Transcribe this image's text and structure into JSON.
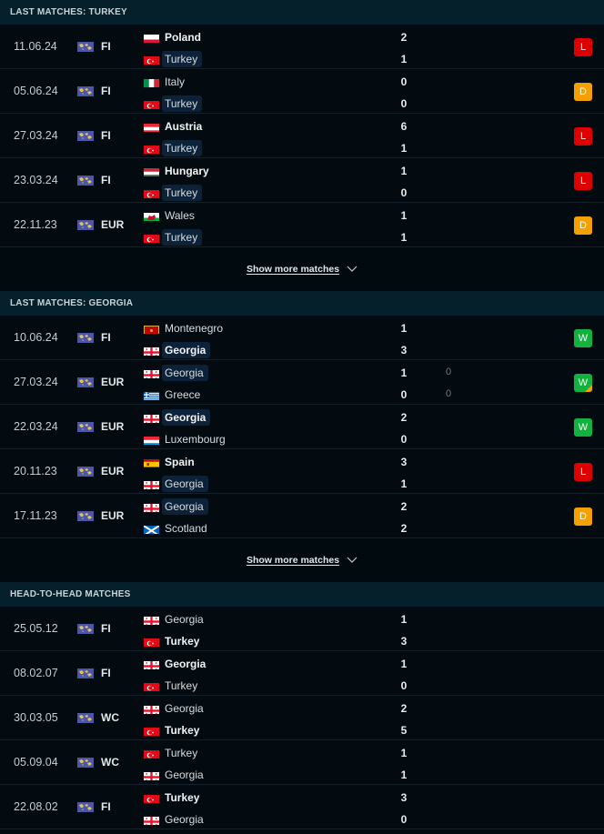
{
  "colors": {
    "loss": "#dc0000",
    "draw": "#f2a100",
    "win": "#12b23e",
    "header_bg": "#05202a",
    "highlight": "#0c2238"
  },
  "show_more_label": "Show more matches",
  "sections": [
    {
      "title": "LAST MATCHES: TURKEY",
      "matches": [
        {
          "date": "11.06.24",
          "comp": "FI",
          "home": {
            "name": "Poland",
            "flag": "poland",
            "bold": true,
            "highlight": false
          },
          "away": {
            "name": "Turkey",
            "flag": "turkey",
            "bold": false,
            "highlight": true
          },
          "home_score": "2",
          "away_score": "1",
          "result": "L"
        },
        {
          "date": "05.06.24",
          "comp": "FI",
          "home": {
            "name": "Italy",
            "flag": "italy",
            "bold": false,
            "highlight": false
          },
          "away": {
            "name": "Turkey",
            "flag": "turkey",
            "bold": false,
            "highlight": true
          },
          "home_score": "0",
          "away_score": "0",
          "result": "D"
        },
        {
          "date": "27.03.24",
          "comp": "FI",
          "home": {
            "name": "Austria",
            "flag": "austria",
            "bold": true,
            "highlight": false
          },
          "away": {
            "name": "Turkey",
            "flag": "turkey",
            "bold": false,
            "highlight": true
          },
          "home_score": "6",
          "away_score": "1",
          "result": "L"
        },
        {
          "date": "23.03.24",
          "comp": "FI",
          "home": {
            "name": "Hungary",
            "flag": "hungary",
            "bold": true,
            "highlight": false
          },
          "away": {
            "name": "Turkey",
            "flag": "turkey",
            "bold": false,
            "highlight": true
          },
          "home_score": "1",
          "away_score": "0",
          "result": "L"
        },
        {
          "date": "22.11.23",
          "comp": "EUR",
          "home": {
            "name": "Wales",
            "flag": "wales",
            "bold": false,
            "highlight": false
          },
          "away": {
            "name": "Turkey",
            "flag": "turkey",
            "bold": false,
            "highlight": true
          },
          "home_score": "1",
          "away_score": "1",
          "result": "D"
        }
      ]
    },
    {
      "title": "LAST MATCHES: GEORGIA",
      "matches": [
        {
          "date": "10.06.24",
          "comp": "FI",
          "home": {
            "name": "Montenegro",
            "flag": "montenegro",
            "bold": false,
            "highlight": false
          },
          "away": {
            "name": "Georgia",
            "flag": "georgia",
            "bold": true,
            "highlight": true
          },
          "home_score": "1",
          "away_score": "3",
          "result": "W"
        },
        {
          "date": "27.03.24",
          "comp": "EUR",
          "home": {
            "name": "Georgia",
            "flag": "georgia",
            "bold": false,
            "highlight": true
          },
          "away": {
            "name": "Greece",
            "flag": "greece",
            "bold": false,
            "highlight": false
          },
          "home_score": "1",
          "away_score": "0",
          "home_pen": "0",
          "away_pen": "0",
          "result": "W",
          "result_note": "penalties"
        },
        {
          "date": "22.03.24",
          "comp": "EUR",
          "home": {
            "name": "Georgia",
            "flag": "georgia",
            "bold": true,
            "highlight": true
          },
          "away": {
            "name": "Luxembourg",
            "flag": "luxembourg",
            "bold": false,
            "highlight": false
          },
          "home_score": "2",
          "away_score": "0",
          "result": "W"
        },
        {
          "date": "20.11.23",
          "comp": "EUR",
          "home": {
            "name": "Spain",
            "flag": "spain",
            "bold": true,
            "highlight": false
          },
          "away": {
            "name": "Georgia",
            "flag": "georgia",
            "bold": false,
            "highlight": true
          },
          "home_score": "3",
          "away_score": "1",
          "result": "L"
        },
        {
          "date": "17.11.23",
          "comp": "EUR",
          "home": {
            "name": "Georgia",
            "flag": "georgia",
            "bold": false,
            "highlight": true
          },
          "away": {
            "name": "Scotland",
            "flag": "scotland",
            "bold": false,
            "highlight": false
          },
          "home_score": "2",
          "away_score": "2",
          "result": "D"
        }
      ]
    },
    {
      "title": "HEAD-TO-HEAD MATCHES",
      "matches": [
        {
          "date": "25.05.12",
          "comp": "FI",
          "home": {
            "name": "Georgia",
            "flag": "georgia",
            "bold": false,
            "highlight": false
          },
          "away": {
            "name": "Turkey",
            "flag": "turkey",
            "bold": true,
            "highlight": false
          },
          "home_score": "1",
          "away_score": "3"
        },
        {
          "date": "08.02.07",
          "comp": "FI",
          "home": {
            "name": "Georgia",
            "flag": "georgia",
            "bold": true,
            "highlight": false
          },
          "away": {
            "name": "Turkey",
            "flag": "turkey",
            "bold": false,
            "highlight": false
          },
          "home_score": "1",
          "away_score": "0"
        },
        {
          "date": "30.03.05",
          "comp": "WC",
          "home": {
            "name": "Georgia",
            "flag": "georgia",
            "bold": false,
            "highlight": false
          },
          "away": {
            "name": "Turkey",
            "flag": "turkey",
            "bold": true,
            "highlight": false
          },
          "home_score": "2",
          "away_score": "5"
        },
        {
          "date": "05.09.04",
          "comp": "WC",
          "home": {
            "name": "Turkey",
            "flag": "turkey",
            "bold": false,
            "highlight": false
          },
          "away": {
            "name": "Georgia",
            "flag": "georgia",
            "bold": false,
            "highlight": false
          },
          "home_score": "1",
          "away_score": "1"
        },
        {
          "date": "22.08.02",
          "comp": "FI",
          "home": {
            "name": "Turkey",
            "flag": "turkey",
            "bold": true,
            "highlight": false
          },
          "away": {
            "name": "Georgia",
            "flag": "georgia",
            "bold": false,
            "highlight": false
          },
          "home_score": "3",
          "away_score": "0"
        }
      ]
    }
  ]
}
